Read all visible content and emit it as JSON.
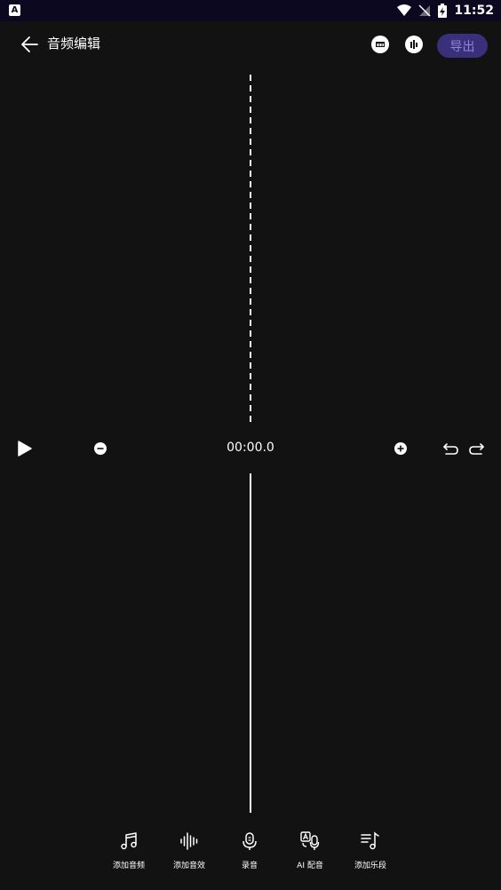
{
  "status_bar": {
    "app_icon_letter": "A",
    "time": "11:52"
  },
  "header": {
    "title": "音频编辑",
    "export_label": "导出"
  },
  "controls": {
    "time": "00:00.0"
  },
  "toolbar": {
    "items": [
      {
        "label": "添加音频",
        "icon": "music-note-icon"
      },
      {
        "label": "添加音效",
        "icon": "sound-wave-icon"
      },
      {
        "label": "录音",
        "icon": "microphone-icon"
      },
      {
        "label": "AI 配音",
        "icon": "ai-voice-icon"
      },
      {
        "label": "添加乐段",
        "icon": "music-list-icon"
      }
    ]
  },
  "colors": {
    "background": "#121212",
    "status_bar": "#0c0820",
    "export_bg": "#3a2f7a",
    "export_text": "#8f86d6"
  }
}
